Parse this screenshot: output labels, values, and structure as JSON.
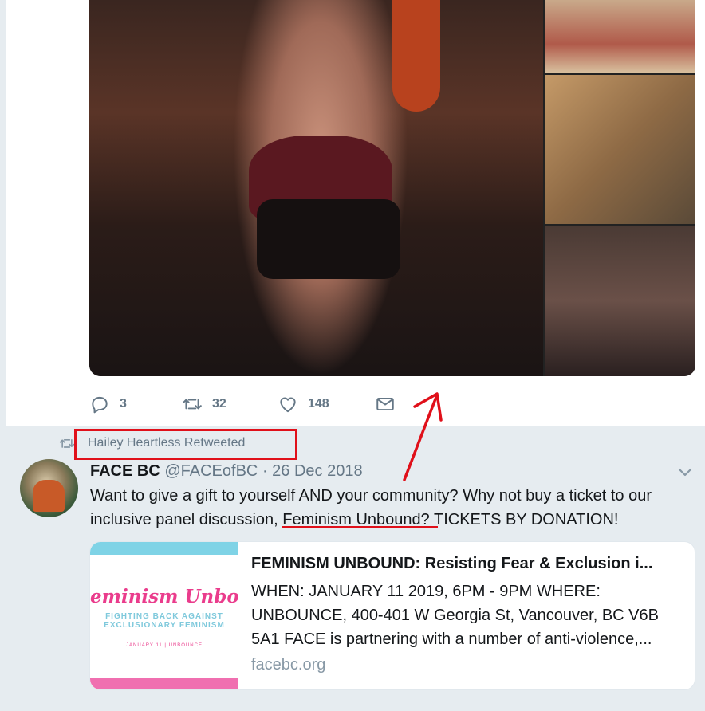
{
  "tweet1": {
    "actions": {
      "reply_count": "3",
      "retweet_count": "32",
      "like_count": "148"
    }
  },
  "retweet_context": {
    "text": "Hailey Heartless Retweeted"
  },
  "tweet2": {
    "name": "FACE BC",
    "handle": "@FACEofBC",
    "dot": "·",
    "date": "26 Dec 2018",
    "text_before": "Want to give a gift to yourself AND your community?  Why not buy a ticket to our inclusive panel discussion, ",
    "text_link": "Feminism Unbound?",
    "text_after": "  TICKETS BY DONATION!",
    "card": {
      "image_brand": "eminism Unboun",
      "image_subtitle": "FIGHTING BACK AGAINST EXCLUSIONARY FEMINISM",
      "image_date": "JANUARY 11 | UNBOUNCE",
      "title": "FEMINISM UNBOUND: Resisting Fear & Exclusion i...",
      "description": "WHEN: JANUARY 11 2019, 6PM - 9PM WHERE: UNBOUNCE, 400-401 W Georgia St, Vancouver, BC V6B 5A1 FACE is partnering with a number of anti-violence,...",
      "domain": "facebc.org"
    }
  },
  "icons": [
    "reply-icon",
    "retweet-icon",
    "like-icon",
    "dm-icon",
    "chevron-down-icon"
  ],
  "colors": {
    "annotation_red": "#e0101a",
    "muted": "#657786",
    "background": "#e6ecf0"
  }
}
